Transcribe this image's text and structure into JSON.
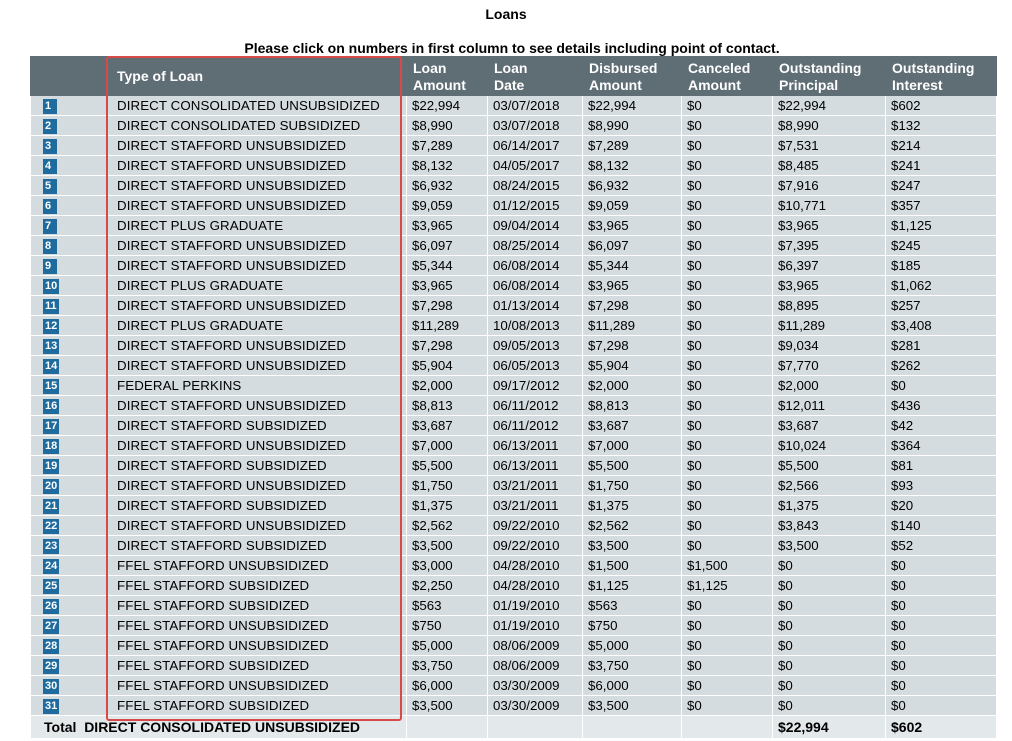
{
  "page": {
    "title": "Loans",
    "instructions": "Please click on numbers in first column to see details including point of contact."
  },
  "headers": {
    "type": "Type of Loan",
    "loan_amount": [
      "Loan",
      "Amount"
    ],
    "loan_date": [
      "Loan",
      "Date"
    ],
    "disbursed": [
      "Disbursed",
      "Amount"
    ],
    "canceled": [
      "Canceled",
      "Amount"
    ],
    "principal": [
      "Outstanding",
      "Principal"
    ],
    "interest": [
      "Outstanding",
      "Interest"
    ]
  },
  "rows": [
    {
      "num": "1",
      "type": "DIRECT CONSOLIDATED UNSUBSIDIZED",
      "amount": "$22,994",
      "date": "03/07/2018",
      "disbursed": "$22,994",
      "canceled": "$0",
      "principal": "$22,994",
      "interest": "$602"
    },
    {
      "num": "2",
      "type": "DIRECT CONSOLIDATED SUBSIDIZED",
      "amount": "$8,990",
      "date": "03/07/2018",
      "disbursed": "$8,990",
      "canceled": "$0",
      "principal": "$8,990",
      "interest": "$132"
    },
    {
      "num": "3",
      "type": "DIRECT STAFFORD UNSUBSIDIZED",
      "amount": "$7,289",
      "date": "06/14/2017",
      "disbursed": "$7,289",
      "canceled": "$0",
      "principal": "$7,531",
      "interest": "$214"
    },
    {
      "num": "4",
      "type": "DIRECT STAFFORD UNSUBSIDIZED",
      "amount": "$8,132",
      "date": "04/05/2017",
      "disbursed": "$8,132",
      "canceled": "$0",
      "principal": "$8,485",
      "interest": "$241"
    },
    {
      "num": "5",
      "type": "DIRECT STAFFORD UNSUBSIDIZED",
      "amount": "$6,932",
      "date": "08/24/2015",
      "disbursed": "$6,932",
      "canceled": "$0",
      "principal": "$7,916",
      "interest": "$247"
    },
    {
      "num": "6",
      "type": "DIRECT STAFFORD UNSUBSIDIZED",
      "amount": "$9,059",
      "date": "01/12/2015",
      "disbursed": "$9,059",
      "canceled": "$0",
      "principal": "$10,771",
      "interest": "$357"
    },
    {
      "num": "7",
      "type": "DIRECT PLUS GRADUATE",
      "amount": "$3,965",
      "date": "09/04/2014",
      "disbursed": "$3,965",
      "canceled": "$0",
      "principal": "$3,965",
      "interest": "$1,125"
    },
    {
      "num": "8",
      "type": "DIRECT STAFFORD UNSUBSIDIZED",
      "amount": "$6,097",
      "date": "08/25/2014",
      "disbursed": "$6,097",
      "canceled": "$0",
      "principal": "$7,395",
      "interest": "$245"
    },
    {
      "num": "9",
      "type": "DIRECT STAFFORD UNSUBSIDIZED",
      "amount": "$5,344",
      "date": "06/08/2014",
      "disbursed": "$5,344",
      "canceled": "$0",
      "principal": "$6,397",
      "interest": "$185"
    },
    {
      "num": "10",
      "type": "DIRECT PLUS GRADUATE",
      "amount": "$3,965",
      "date": "06/08/2014",
      "disbursed": "$3,965",
      "canceled": "$0",
      "principal": "$3,965",
      "interest": "$1,062"
    },
    {
      "num": "11",
      "type": "DIRECT STAFFORD UNSUBSIDIZED",
      "amount": "$7,298",
      "date": "01/13/2014",
      "disbursed": "$7,298",
      "canceled": "$0",
      "principal": "$8,895",
      "interest": "$257"
    },
    {
      "num": "12",
      "type": "DIRECT PLUS GRADUATE",
      "amount": "$11,289",
      "date": "10/08/2013",
      "disbursed": "$11,289",
      "canceled": "$0",
      "principal": "$11,289",
      "interest": "$3,408"
    },
    {
      "num": "13",
      "type": "DIRECT STAFFORD UNSUBSIDIZED",
      "amount": "$7,298",
      "date": "09/05/2013",
      "disbursed": "$7,298",
      "canceled": "$0",
      "principal": "$9,034",
      "interest": "$281"
    },
    {
      "num": "14",
      "type": "DIRECT STAFFORD UNSUBSIDIZED",
      "amount": "$5,904",
      "date": "06/05/2013",
      "disbursed": "$5,904",
      "canceled": "$0",
      "principal": "$7,770",
      "interest": "$262"
    },
    {
      "num": "15",
      "type": "FEDERAL PERKINS",
      "amount": "$2,000",
      "date": "09/17/2012",
      "disbursed": "$2,000",
      "canceled": "$0",
      "principal": "$2,000",
      "interest": "$0"
    },
    {
      "num": "16",
      "type": "DIRECT STAFFORD UNSUBSIDIZED",
      "amount": "$8,813",
      "date": "06/11/2012",
      "disbursed": "$8,813",
      "canceled": "$0",
      "principal": "$12,011",
      "interest": "$436"
    },
    {
      "num": "17",
      "type": "DIRECT STAFFORD SUBSIDIZED",
      "amount": "$3,687",
      "date": "06/11/2012",
      "disbursed": "$3,687",
      "canceled": "$0",
      "principal": "$3,687",
      "interest": "$42"
    },
    {
      "num": "18",
      "type": "DIRECT STAFFORD UNSUBSIDIZED",
      "amount": "$7,000",
      "date": "06/13/2011",
      "disbursed": "$7,000",
      "canceled": "$0",
      "principal": "$10,024",
      "interest": "$364"
    },
    {
      "num": "19",
      "type": "DIRECT STAFFORD SUBSIDIZED",
      "amount": "$5,500",
      "date": "06/13/2011",
      "disbursed": "$5,500",
      "canceled": "$0",
      "principal": "$5,500",
      "interest": "$81"
    },
    {
      "num": "20",
      "type": "DIRECT STAFFORD UNSUBSIDIZED",
      "amount": "$1,750",
      "date": "03/21/2011",
      "disbursed": "$1,750",
      "canceled": "$0",
      "principal": "$2,566",
      "interest": "$93"
    },
    {
      "num": "21",
      "type": "DIRECT STAFFORD SUBSIDIZED",
      "amount": "$1,375",
      "date": "03/21/2011",
      "disbursed": "$1,375",
      "canceled": "$0",
      "principal": "$1,375",
      "interest": "$20"
    },
    {
      "num": "22",
      "type": "DIRECT STAFFORD UNSUBSIDIZED",
      "amount": "$2,562",
      "date": "09/22/2010",
      "disbursed": "$2,562",
      "canceled": "$0",
      "principal": "$3,843",
      "interest": "$140"
    },
    {
      "num": "23",
      "type": "DIRECT STAFFORD SUBSIDIZED",
      "amount": "$3,500",
      "date": "09/22/2010",
      "disbursed": "$3,500",
      "canceled": "$0",
      "principal": "$3,500",
      "interest": "$52"
    },
    {
      "num": "24",
      "type": "FFEL STAFFORD UNSUBSIDIZED",
      "amount": "$3,000",
      "date": "04/28/2010",
      "disbursed": "$1,500",
      "canceled": "$1,500",
      "principal": "$0",
      "interest": "$0"
    },
    {
      "num": "25",
      "type": "FFEL STAFFORD SUBSIDIZED",
      "amount": "$2,250",
      "date": "04/28/2010",
      "disbursed": "$1,125",
      "canceled": "$1,125",
      "principal": "$0",
      "interest": "$0"
    },
    {
      "num": "26",
      "type": "FFEL STAFFORD SUBSIDIZED",
      "amount": "$563",
      "date": "01/19/2010",
      "disbursed": "$563",
      "canceled": "$0",
      "principal": "$0",
      "interest": "$0"
    },
    {
      "num": "27",
      "type": "FFEL STAFFORD UNSUBSIDIZED",
      "amount": "$750",
      "date": "01/19/2010",
      "disbursed": "$750",
      "canceled": "$0",
      "principal": "$0",
      "interest": "$0"
    },
    {
      "num": "28",
      "type": "FFEL STAFFORD UNSUBSIDIZED",
      "amount": "$5,000",
      "date": "08/06/2009",
      "disbursed": "$5,000",
      "canceled": "$0",
      "principal": "$0",
      "interest": "$0"
    },
    {
      "num": "29",
      "type": "FFEL STAFFORD SUBSIDIZED",
      "amount": "$3,750",
      "date": "08/06/2009",
      "disbursed": "$3,750",
      "canceled": "$0",
      "principal": "$0",
      "interest": "$0"
    },
    {
      "num": "30",
      "type": "FFEL STAFFORD UNSUBSIDIZED",
      "amount": "$6,000",
      "date": "03/30/2009",
      "disbursed": "$6,000",
      "canceled": "$0",
      "principal": "$0",
      "interest": "$0"
    },
    {
      "num": "31",
      "type": "FFEL STAFFORD SUBSIDIZED",
      "amount": "$3,500",
      "date": "03/30/2009",
      "disbursed": "$3,500",
      "canceled": "$0",
      "principal": "$0",
      "interest": "$0"
    }
  ],
  "total": {
    "label": "Total",
    "type": "DIRECT CONSOLIDATED UNSUBSIDIZED",
    "principal": "$22,994",
    "interest": "$602"
  },
  "colors": {
    "header_bg": "#5f6d75",
    "row_bg": "#d4dcdf",
    "number_link_bg": "#1f6b9e",
    "highlight_border": "#d84a4a"
  }
}
